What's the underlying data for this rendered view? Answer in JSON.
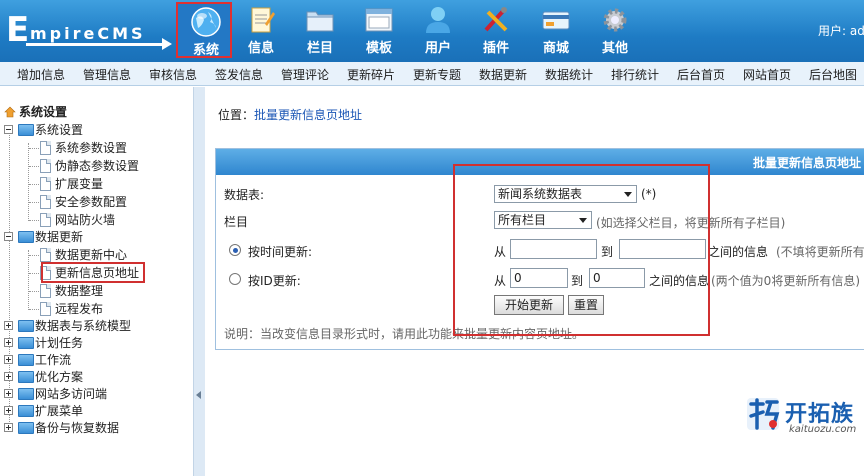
{
  "header": {
    "user_label": "用户: ad",
    "nav": [
      {
        "label": "系统",
        "icon": "globe-icon",
        "active": true
      },
      {
        "label": "信息",
        "icon": "notepad-icon"
      },
      {
        "label": "栏目",
        "icon": "folder-icon"
      },
      {
        "label": "模板",
        "icon": "window-icon"
      },
      {
        "label": "用户",
        "icon": "user-icon"
      },
      {
        "label": "插件",
        "icon": "tools-icon"
      },
      {
        "label": "商城",
        "icon": "card-icon"
      },
      {
        "label": "其他",
        "icon": "gear-icon"
      }
    ],
    "logo_text": "EmpireCMS"
  },
  "submenu": [
    "增加信息",
    "管理信息",
    "审核信息",
    "签发信息",
    "管理评论",
    "更新碎片",
    "更新专题",
    "数据更新",
    "数据统计",
    "排行统计",
    "后台首页",
    "网站首页",
    "后台地图"
  ],
  "sidebar": {
    "root_title": "系统设置",
    "groups": [
      {
        "label": "系统设置",
        "expanded": true,
        "items": [
          "系统参数设置",
          "伪静态参数设置",
          "扩展变量",
          "安全参数配置",
          "网站防火墙"
        ]
      },
      {
        "label": "数据更新",
        "expanded": true,
        "items": [
          "数据更新中心",
          "更新信息页地址",
          "数据整理",
          "远程发布"
        ]
      },
      {
        "label": "数据表与系统模型",
        "expanded": false
      },
      {
        "label": "计划任务",
        "expanded": false
      },
      {
        "label": "工作流",
        "expanded": false
      },
      {
        "label": "优化方案",
        "expanded": false
      },
      {
        "label": "网站多访问端",
        "expanded": false
      },
      {
        "label": "扩展菜单",
        "expanded": false
      },
      {
        "label": "备份与恢复数据",
        "expanded": false
      }
    ]
  },
  "main": {
    "location_prefix": "位置：",
    "location_link": "批量更新信息页地址",
    "panel_title": "批量更新信息页地址",
    "form": {
      "table_label": "数据表:",
      "table_value": "新闻系统数据表",
      "table_suffix": "(*)",
      "column_label": "栏目",
      "column_value": "所有栏目",
      "column_hint": "(如选择父栏目，将更新所有子栏目)",
      "by_time_label": "按时间更新:",
      "from": "从",
      "to": "到",
      "time_between": "之间的信息",
      "time_hint": "(不填将更新所有",
      "by_id_label": "按ID更新:",
      "id_from_value": "0",
      "id_to_value": "0",
      "id_between": "之间的信息",
      "id_hint": "(两个值为0将更新所有信息)",
      "start_button": "开始更新",
      "reset_button": "重置",
      "note": "说明：当改变信息目录形式时，请用此功能来批量更新内容页地址。"
    }
  },
  "watermark": {
    "name": "开拓族",
    "url": "kaituozu.com"
  }
}
